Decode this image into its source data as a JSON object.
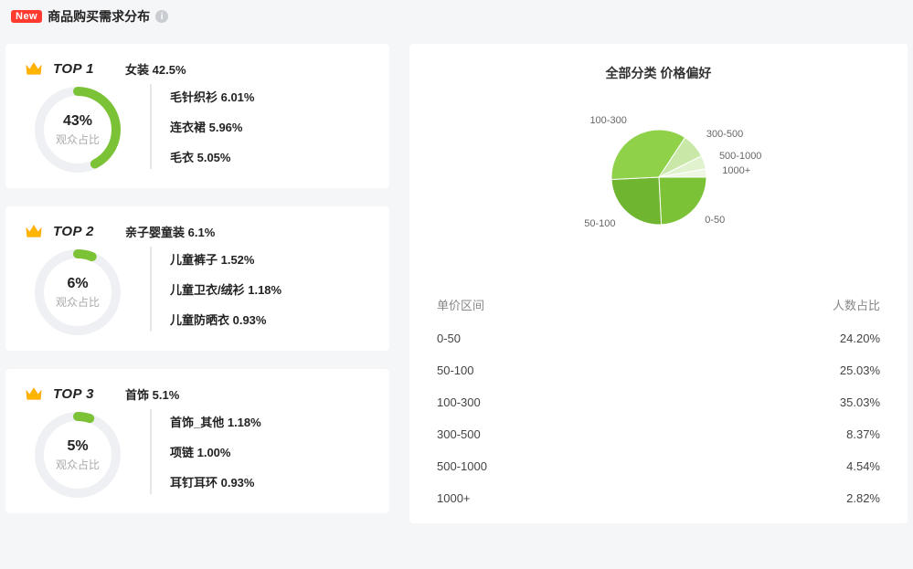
{
  "header": {
    "new_badge": "New",
    "title": "商品购买需求分布"
  },
  "donut_label": "观众占比",
  "tops": [
    {
      "rank": "TOP 1",
      "category": "女装 42.5%",
      "pct_text": "43%",
      "pct_value": 42.5,
      "subs": [
        "毛针织衫 6.01%",
        "连衣裙 5.96%",
        "毛衣 5.05%"
      ]
    },
    {
      "rank": "TOP 2",
      "category": "亲子婴童装 6.1%",
      "pct_text": "6%",
      "pct_value": 6.1,
      "subs": [
        "儿童裤子 1.52%",
        "儿童卫衣/绒衫 1.18%",
        "儿童防晒衣 0.93%"
      ]
    },
    {
      "rank": "TOP 3",
      "category": "首饰 5.1%",
      "pct_text": "5%",
      "pct_value": 5.1,
      "subs": [
        "首饰_其他 1.18%",
        "项链 1.00%",
        "耳钉耳环 0.93%"
      ]
    }
  ],
  "right": {
    "title": "全部分类 价格偏好",
    "table_headers": {
      "range": "单价区间",
      "share": "人数占比"
    },
    "rows": [
      {
        "range": "0-50",
        "share": "24.20%"
      },
      {
        "range": "50-100",
        "share": "25.03%"
      },
      {
        "range": "100-300",
        "share": "35.03%"
      },
      {
        "range": "300-500",
        "share": "8.37%"
      },
      {
        "range": "500-1000",
        "share": "4.54%"
      },
      {
        "range": "1000+",
        "share": "2.82%"
      }
    ]
  },
  "chart_data": {
    "type": "pie",
    "title": "全部分类 价格偏好",
    "series": [
      {
        "name": "0-50",
        "value": 24.2
      },
      {
        "name": "50-100",
        "value": 25.03
      },
      {
        "name": "100-300",
        "value": 35.03
      },
      {
        "name": "300-500",
        "value": 8.37
      },
      {
        "name": "500-1000",
        "value": 4.54
      },
      {
        "name": "1000+",
        "value": 2.82
      }
    ],
    "donuts": [
      {
        "label": "TOP 1",
        "value": 43,
        "unit": "%"
      },
      {
        "label": "TOP 2",
        "value": 6,
        "unit": "%"
      },
      {
        "label": "TOP 3",
        "value": 5,
        "unit": "%"
      }
    ]
  }
}
